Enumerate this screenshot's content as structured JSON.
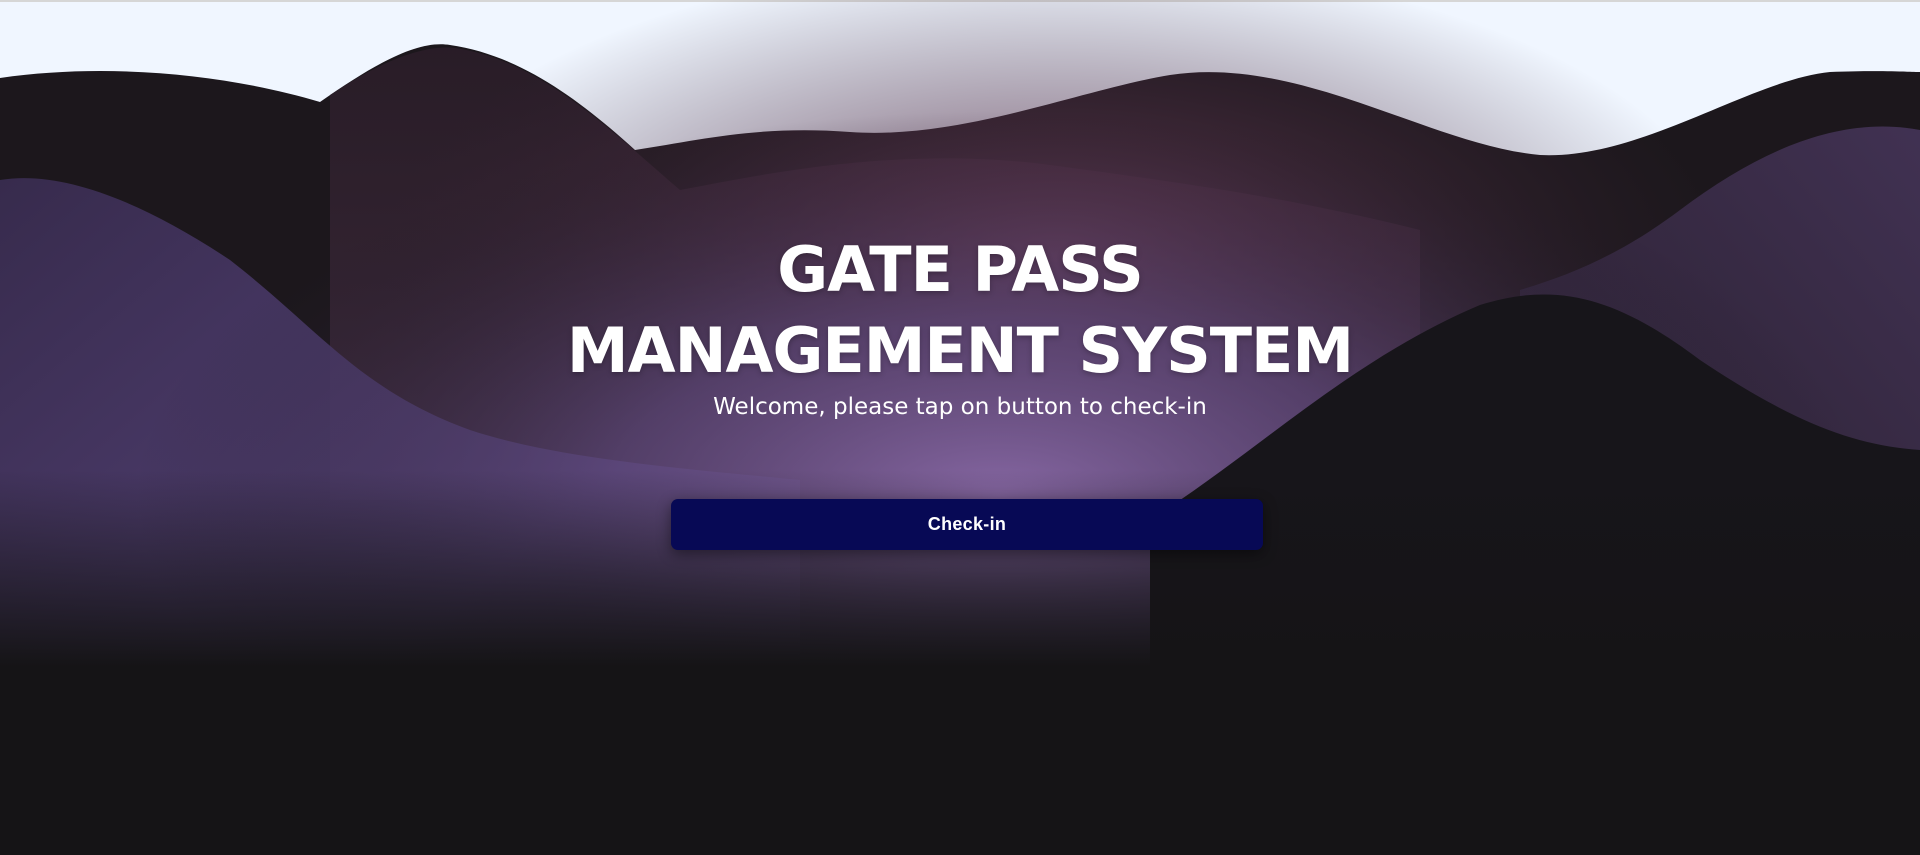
{
  "hero": {
    "title_line1": "GATE PASS",
    "title_line2": "MANAGEMENT SYSTEM",
    "subtitle": "Welcome, please tap on button to check-in"
  },
  "actions": {
    "checkin_label": "Check-in"
  },
  "colors": {
    "page_background": "#f0f6ff",
    "dark_background": "#151416",
    "button_background": "#070955",
    "text": "#ffffff"
  }
}
